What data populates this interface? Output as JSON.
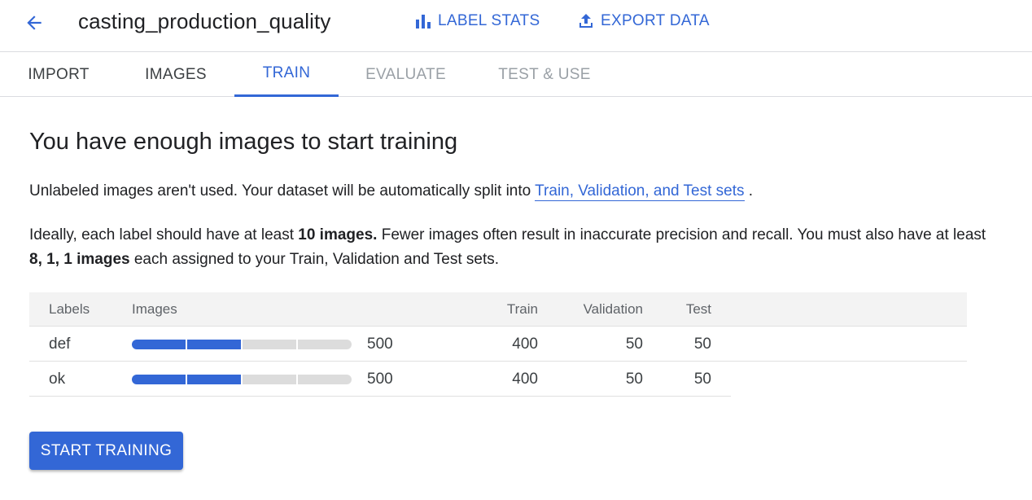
{
  "header": {
    "title": "casting_production_quality",
    "actions": [
      {
        "label": "LABEL STATS",
        "icon": "bar-chart-icon"
      },
      {
        "label": "EXPORT DATA",
        "icon": "upload-icon"
      }
    ],
    "back_icon": "arrow-back-icon"
  },
  "tabs": [
    {
      "label": "IMPORT",
      "state": "normal"
    },
    {
      "label": "IMAGES",
      "state": "normal"
    },
    {
      "label": "TRAIN",
      "state": "active"
    },
    {
      "label": "EVALUATE",
      "state": "disabled"
    },
    {
      "label": "TEST & USE",
      "state": "disabled"
    }
  ],
  "main": {
    "heading": "You have enough images to start training",
    "para1": {
      "text": "Unlabeled images aren't used. Your dataset will be automatically split into ",
      "link": "Train, Validation, and Test sets",
      "end": " ."
    },
    "para2": {
      "t1": "Ideally, each label should have at least ",
      "b1": "10 images.",
      "t2": " Fewer images often result in inaccurate precision and recall. You must also have at least ",
      "b2": "8, 1, 1 images",
      "t3": " each assigned to your Train, Validation and Test sets."
    }
  },
  "table": {
    "headers": {
      "labels": "Labels",
      "images": "Images",
      "train": "Train",
      "validation": "Validation",
      "test": "Test"
    },
    "rows": [
      {
        "label": "def",
        "images": "500",
        "train": "400",
        "validation": "50",
        "test": "50",
        "bar_filled_segments": 2,
        "bar_total_segments": 4
      },
      {
        "label": "ok",
        "images": "500",
        "train": "400",
        "validation": "50",
        "test": "50",
        "bar_filled_segments": 2,
        "bar_total_segments": 4
      }
    ]
  },
  "start_button": "START TRAINING",
  "colors": {
    "accent": "#3367d6",
    "bar_empty": "#dcdcdc",
    "header_bg": "#f3f3f3"
  }
}
